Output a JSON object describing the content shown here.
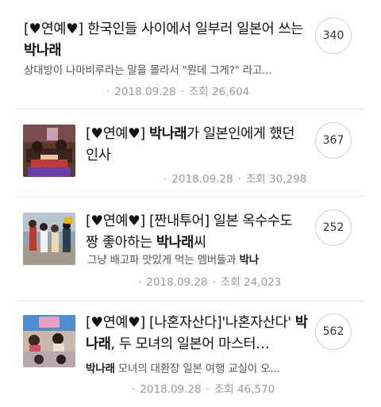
{
  "articles": [
    {
      "title_pre": "[♥연예♥] 한국인들 사이에서 일부러 일본어 쓰는 ",
      "title_hl": "박나래",
      "title_post": "",
      "snippet_hl": "",
      "snippet": "상대방이 나마비루라는 말을 몰라서 \"뭔데 그게?\" 라고...",
      "date": "2018.09.28",
      "views": "조회 26,604",
      "comments": "340"
    },
    {
      "title_pre": "[♥연예♥] ",
      "title_hl": "박나래",
      "title_post": "가 일본인에게 했던 인사",
      "snippet_hl": "",
      "snippet": "",
      "date": "2018.09.28",
      "views": "조회 30,298",
      "comments": "367"
    },
    {
      "title_pre": "[♥연예♥] [짠내투어] 일본 옥수수도 짱 좋아하는 ",
      "title_hl": "박나래",
      "title_post": "씨",
      "snippet_hl": "박나",
      "snippet": "그냥 배고파 맛있게 먹는 멤버들과 ",
      "date": "2018.09.28",
      "views": "조회 24,023",
      "comments": "252"
    },
    {
      "title_pre": "[♥연예♥] [나혼자산다]'나혼자산다' ",
      "title_hl": "박나래",
      "title_post": ", 두 모녀의 일본어 마스터…",
      "snippet_hl": "박나래",
      "snippet": " 모녀의 대환장 일본 여행 교실이 오...",
      "date": "2018.09.28",
      "views": "조회 46,570",
      "comments": "562"
    }
  ]
}
